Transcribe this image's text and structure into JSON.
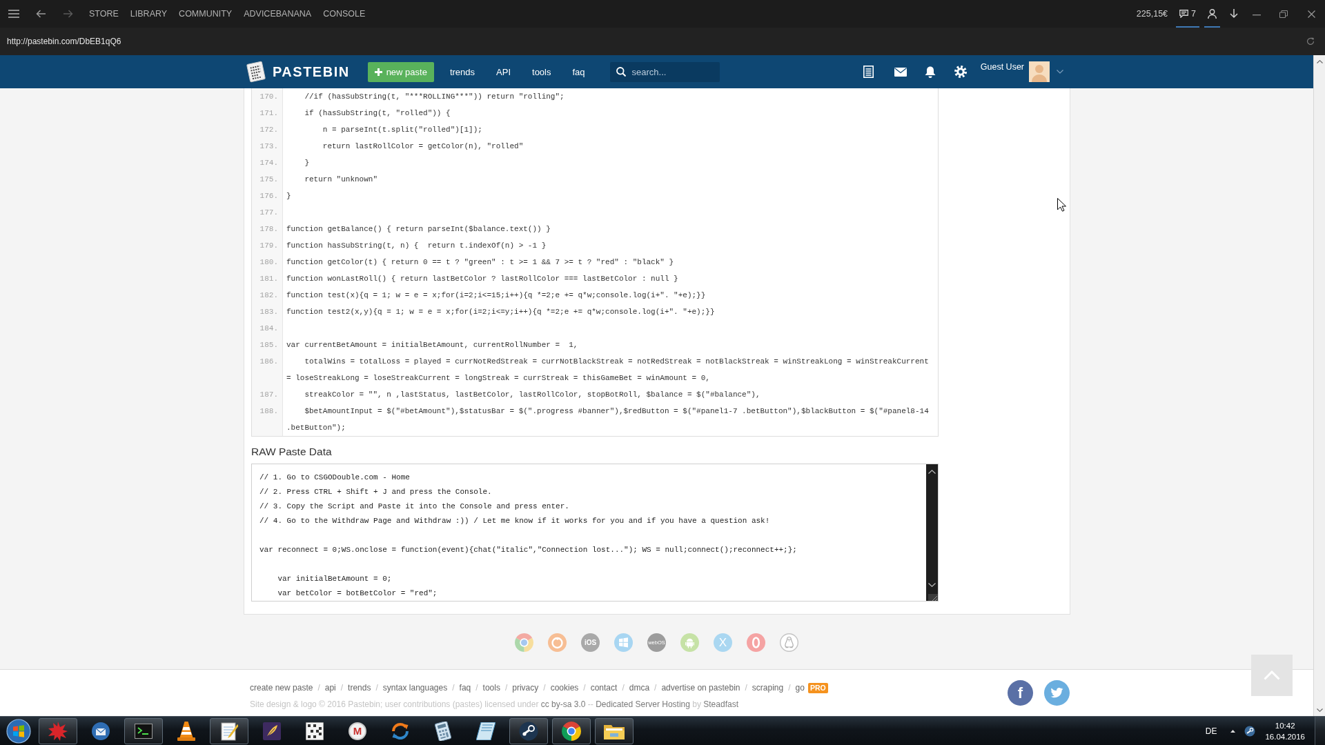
{
  "steam_bar": {
    "nav": [
      "STORE",
      "LIBRARY",
      "COMMUNITY",
      "ADVICEBANANA",
      "CONSOLE"
    ],
    "wallet": "225,15€",
    "notifications": "7"
  },
  "address_bar": {
    "url": "http://pastebin.com/DbEB1qQ6"
  },
  "header": {
    "logo": "PASTEBIN",
    "new_paste": "new paste",
    "nav": [
      "trends",
      "API",
      "tools",
      "faq"
    ],
    "search": {
      "placeholder": "search..."
    },
    "user": "Guest User"
  },
  "code": {
    "lines": [
      {
        "number": "170.",
        "text": "    //if (hasSubString(t, \"***ROLLING***\")) return \"rolling\";"
      },
      {
        "number": "171.",
        "text": "    if (hasSubString(t, \"rolled\")) {"
      },
      {
        "number": "172.",
        "text": "        n = parseInt(t.split(\"rolled\")[1]);"
      },
      {
        "number": "173.",
        "text": "        return lastRollColor = getColor(n), \"rolled\""
      },
      {
        "number": "174.",
        "text": "    }"
      },
      {
        "number": "175.",
        "text": "    return \"unknown\""
      },
      {
        "number": "176.",
        "text": "}"
      },
      {
        "number": "177."
      },
      {
        "number": "178.",
        "text": "function getBalance() { return parseInt($balance.text()) }"
      },
      {
        "number": "179.",
        "text": "function hasSubString(t, n) {  return t.indexOf(n) > -1 }"
      },
      {
        "number": "180.",
        "text": "function getColor(t) { return 0 == t ? \"green\" : t >= 1 && 7 >= t ? \"red\" : \"black\" }"
      },
      {
        "number": "181.",
        "text": "function wonLastRoll() { return lastBetColor ? lastRollColor === lastBetColor : null }"
      },
      {
        "number": "182.",
        "text": "function test(x){q = 1; w = e = x;for(i=2;i<=15;i++){q *=2;e += q*w;console.log(i+\". \"+e);}}"
      },
      {
        "number": "183.",
        "text": "function test2(x,y){q = 1; w = e = x;for(i=2;i<=y;i++){q *=2;e += q*w;console.log(i+\". \"+e);}}"
      },
      {
        "number": "184."
      },
      {
        "number": "185.",
        "text": "var currentBetAmount = initialBetAmount, currentRollNumber =  1,"
      },
      {
        "number": "186.",
        "text": "    totalWins = totalLoss = played = currNotRedStreak = currNotBlackStreak = notRedStreak = notBlackStreak = winStreakLong = winStreakCurrent = loseStreakLong = loseStreakCurrent = longStreak = currStreak = thisGameBet = winAmount = 0,"
      },
      {
        "number": "187.",
        "text": "    streakColor = \"\", n ,lastStatus, lastBetColor, lastRollColor, stopBotRoll, $balance = $(\"#balance\"),"
      },
      {
        "number": "188.",
        "text": "    $betAmountInput = $(\"#betAmount\"),$statusBar = $(\".progress #banner\"),$redButton = $(\"#panel1-7 .betButton\"),$blackButton = $(\"#panel8-14 .betButton\");"
      }
    ]
  },
  "raw_paste": {
    "title": "RAW Paste Data",
    "blocks": [
      [
        "// 1. Go to CSGODouble.com - Home",
        "// 2. Press CTRL + Shift + J and press the Console.",
        "// 3. Copy the Script and Paste it into the Console and press enter.",
        "// 4. Go to the Withdraw Page and Withdraw :)) / Let me know if it works for you and if you have a question ask!"
      ],
      [
        "var reconnect = 0;WS.onclose = function(event){chat(\"italic\",\"Connection lost...\"); WS = null;connect();reconnect++;};"
      ],
      [
        "    var initialBetAmount = 0;",
        "    var betColor = botBetColor = \"red\";"
      ]
    ]
  },
  "platforms": [
    {
      "kind": "chrome"
    },
    {
      "kind": "firefox"
    },
    {
      "kind": "ios",
      "label": "iOS"
    },
    {
      "kind": "windows"
    },
    {
      "kind": "webos",
      "label": "webOS"
    },
    {
      "kind": "android"
    },
    {
      "kind": "osx",
      "label": "X"
    },
    {
      "kind": "opera"
    },
    {
      "kind": "linux"
    }
  ],
  "footer": {
    "links": [
      {
        "label": "create new paste",
        "separator": "/"
      },
      {
        "label": "api",
        "separator": "/"
      },
      {
        "label": "trends",
        "separator": "/"
      },
      {
        "label": "syntax languages",
        "separator": "/"
      },
      {
        "label": "faq",
        "separator": "/"
      },
      {
        "label": "tools",
        "separator": "/"
      },
      {
        "label": "privacy",
        "separator": "/"
      },
      {
        "label": "cookies",
        "separator": "/"
      },
      {
        "label": "contact",
        "separator": "/"
      },
      {
        "label": "dmca",
        "separator": "/"
      },
      {
        "label": "advertise on pastebin",
        "separator": "/"
      },
      {
        "label": "scraping",
        "separator": "/"
      },
      {
        "label": "go"
      }
    ],
    "pro_badge": "PRO",
    "copyright": [
      {
        "kind": "plain",
        "text": "Site design & logo © 2016 Pastebin; user contributions (pastes) licensed under"
      },
      {
        "kind": "link",
        "text": "cc by-sa 3.0"
      },
      {
        "kind": "plain",
        "text": "--"
      },
      {
        "kind": "link",
        "text": "Dedicated Server Hosting"
      },
      {
        "kind": "plain",
        "text": "by"
      },
      {
        "kind": "link",
        "text": "Steadfast"
      }
    ],
    "social": [
      {
        "kind": "facebook",
        "label": "f"
      },
      {
        "kind": "twitter"
      }
    ]
  },
  "taskbar": {
    "apps": [
      {
        "kind": "splat",
        "running": true
      },
      {
        "kind": "mail",
        "running": false
      },
      {
        "kind": "terminal",
        "running": true
      },
      {
        "kind": "cone",
        "running": false
      },
      {
        "kind": "notepad",
        "running": true
      },
      {
        "kind": "tex",
        "running": false
      },
      {
        "kind": "grid",
        "running": false
      },
      {
        "kind": "letter",
        "label": "M",
        "running": false
      },
      {
        "kind": "sync",
        "running": false
      },
      {
        "kind": "calculator",
        "running": false
      },
      {
        "kind": "notebook",
        "running": false
      },
      {
        "kind": "steam",
        "running": true
      },
      {
        "kind": "chrome",
        "running": true
      },
      {
        "kind": "folder",
        "running": true
      }
    ],
    "language": "DE",
    "time": "10:42",
    "date": "16.04.2016"
  }
}
